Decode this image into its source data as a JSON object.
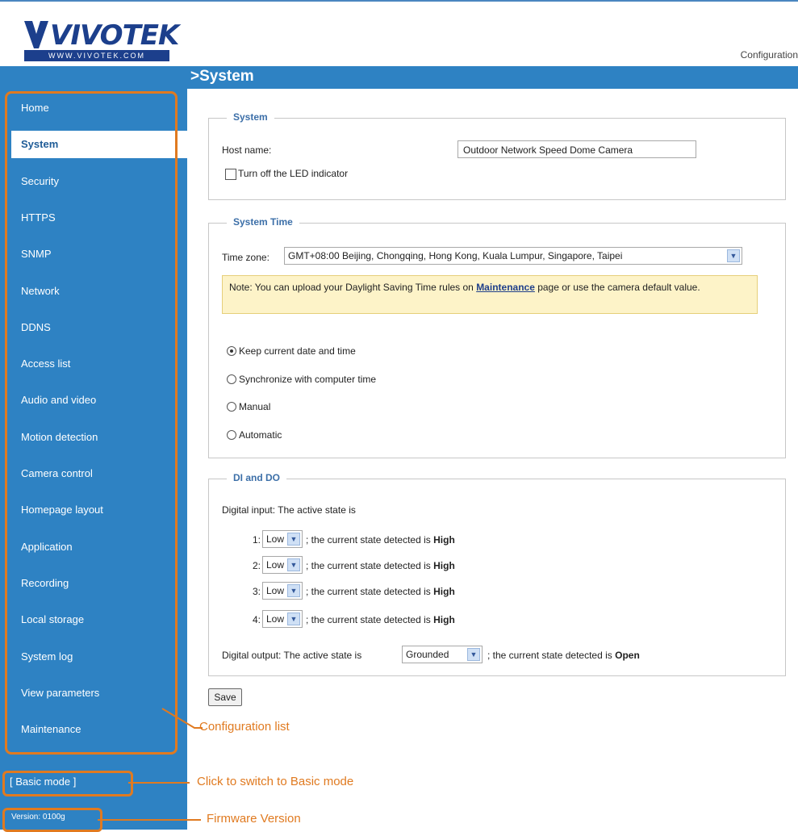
{
  "header": {
    "logo_text": "VIVOTEK",
    "logo_url": "WWW.VIVOTEK.COM",
    "config_link": "Configuration"
  },
  "page_title": ">System",
  "sidebar": {
    "items": [
      {
        "label": "Home"
      },
      {
        "label": "System"
      },
      {
        "label": "Security"
      },
      {
        "label": "HTTPS"
      },
      {
        "label": "SNMP"
      },
      {
        "label": "Network"
      },
      {
        "label": "DDNS"
      },
      {
        "label": "Access list"
      },
      {
        "label": "Audio and video"
      },
      {
        "label": "Motion detection"
      },
      {
        "label": "Camera control"
      },
      {
        "label": "Homepage layout"
      },
      {
        "label": "Application"
      },
      {
        "label": "Recording"
      },
      {
        "label": "Local storage"
      },
      {
        "label": "System log"
      },
      {
        "label": "View parameters"
      },
      {
        "label": "Maintenance"
      }
    ],
    "active": "System",
    "basic_mode": "[ Basic mode ]",
    "version": "Version: 0100g"
  },
  "system": {
    "title": "System",
    "host_label": "Host name:",
    "host_value": "Outdoor Network Speed Dome Camera",
    "led_label": "Turn off the LED indicator"
  },
  "system_time": {
    "title": "System Time",
    "timezone_label": "Time zone:",
    "timezone_value": "GMT+08:00 Beijing, Chongqing, Hong Kong, Kuala Lumpur, Singapore, Taipei",
    "note_before": "Note: You can upload your Daylight Saving Time rules on ",
    "note_link": "Maintenance",
    "note_after": " page or use the camera default value.",
    "options": [
      "Keep current date and time",
      "Synchronize with computer time",
      "Manual",
      "Automatic"
    ],
    "selected": "Keep current date and time"
  },
  "di_do": {
    "title": "DI and DO",
    "input_label": "Digital input: The active state is",
    "inputs": [
      {
        "index": "1:",
        "value": "Low",
        "text": "; the current state detected is",
        "state": "High"
      },
      {
        "index": "2:",
        "value": "Low",
        "text": "; the current state detected is",
        "state": "High"
      },
      {
        "index": "3:",
        "value": "Low",
        "text": "; the current state detected is",
        "state": "High"
      },
      {
        "index": "4:",
        "value": "Low",
        "text": "; the current state detected is",
        "state": "High"
      }
    ],
    "output_label": "Digital output: The active state is",
    "output_value": "Grounded",
    "output_text": "; the current state detected is",
    "output_state": "Open"
  },
  "save_label": "Save",
  "callouts": {
    "config_list": "Configuration list",
    "basic_mode": "Click to switch to Basic mode",
    "firmware": "Firmware Version"
  },
  "colors": {
    "sidebar": "#2e82c3",
    "annotation": "#e07a20",
    "note_bg": "#fdf3c8"
  }
}
